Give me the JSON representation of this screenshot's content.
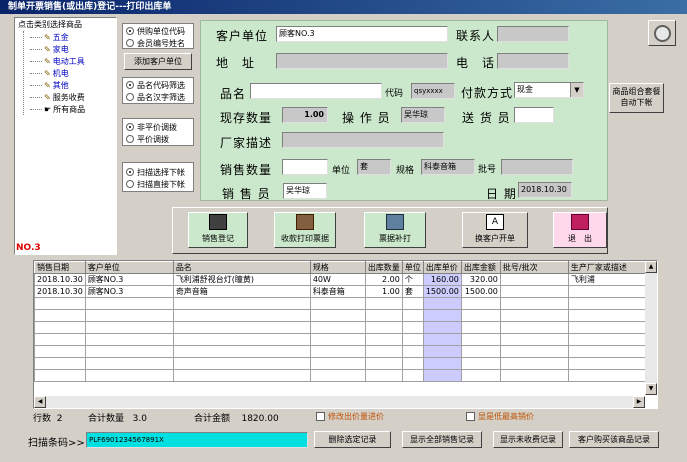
{
  "window": {
    "title": "制单开票销售(或出库)登记---打印出库单"
  },
  "tree": {
    "header": "点击类别选择商品",
    "items": [
      {
        "label": "五金"
      },
      {
        "label": "家电"
      },
      {
        "label": "电动工具"
      },
      {
        "label": "机电"
      },
      {
        "label": "其他"
      },
      {
        "label": "服务收费"
      },
      {
        "label": "所有商品"
      }
    ],
    "selected_code": "NO.3"
  },
  "options": {
    "group1": [
      "供购单位代码",
      "会员编号姓名"
    ],
    "add_customer": "添加客户单位",
    "group2": [
      "品名代码筛选",
      "品名汉字筛选"
    ],
    "group3": [
      "非平价调拨",
      "平价调拨"
    ],
    "group4": [
      "扫描选择下帐",
      "扫描直接下帐"
    ]
  },
  "form": {
    "customer_label": "客户单位",
    "customer_value": "顾客NO.3",
    "contact_label": "联系人",
    "contact_value": "",
    "address_label": "地　址",
    "address_value": "",
    "phone_label": "电　话",
    "phone_value": "",
    "product_label": "品名",
    "product_value": "",
    "code_label": "代码",
    "code_value": "qsyxxxx",
    "payment_label": "付款方式",
    "payment_value": "现金",
    "stock_label": "现存数量",
    "stock_value": "1.00",
    "operator_label": "操 作 员",
    "operator_value": "吴华琼",
    "delivery_label": "送 货 员",
    "delivery_value": "",
    "maker_label": "厂家描述",
    "maker_value": "",
    "qty_label": "销售数量",
    "qty_value": "",
    "unit_label": "单位",
    "unit_value": "套",
    "spec_label": "规格",
    "spec_value": "科泰音箱",
    "batch_label": "批号",
    "batch_value": "",
    "seller_label": "销 售 员",
    "seller_value": "吴华琼",
    "date_label": "日 期",
    "date_value": "2018.10.30",
    "combo_button": "商品组合套餐自动下帐"
  },
  "toolbar": {
    "register": "销售登记",
    "print_receipt": "收款打印票据",
    "reprint": "票据补打",
    "switch_customer": "换客户开单",
    "exit": "退　出"
  },
  "table": {
    "columns": [
      "销售日期",
      "客户单位",
      "品名",
      "规格",
      "出库数量",
      "单位",
      "出库单价",
      "出库金额",
      "批号/批次",
      "生产厂家或描述"
    ],
    "rows": [
      [
        "2018.10.30",
        "顾客NO.3",
        "飞利浦舒视台灯(瞳黄)",
        "40W",
        "2.00",
        "个",
        "160.00",
        "320.00",
        "",
        "飞利浦"
      ],
      [
        "2018.10.30",
        "顾客NO.3",
        "奇声音箱",
        "科泰音箱",
        "1.00",
        "套",
        "1500.00",
        "1500.00",
        "",
        ""
      ]
    ]
  },
  "summary": {
    "rows_label": "行数",
    "rows_value": "2",
    "qty_label": "合计数量",
    "qty_value": "3.0",
    "amount_label": "合计金额",
    "amount_value": "1820.00",
    "modify_price": "修改出价量进价",
    "show_min_price": "显是低最高销价"
  },
  "bottom": {
    "scan_label": "扫描条码>>",
    "scan_value": "PLF6901234567891X",
    "delete_btn": "删除选定记录",
    "show_all_btn": "显示全部销售记录",
    "show_unpaid_btn": "显示未收费记录",
    "customer_history_btn": "客户购买该商品记录"
  },
  "colors": {
    "form_bg": "#cce8cc",
    "title_bg": "#0a246a",
    "scan_bg": "#00e0e0",
    "price_col": "#ccccff",
    "code_red": "#e00000"
  }
}
